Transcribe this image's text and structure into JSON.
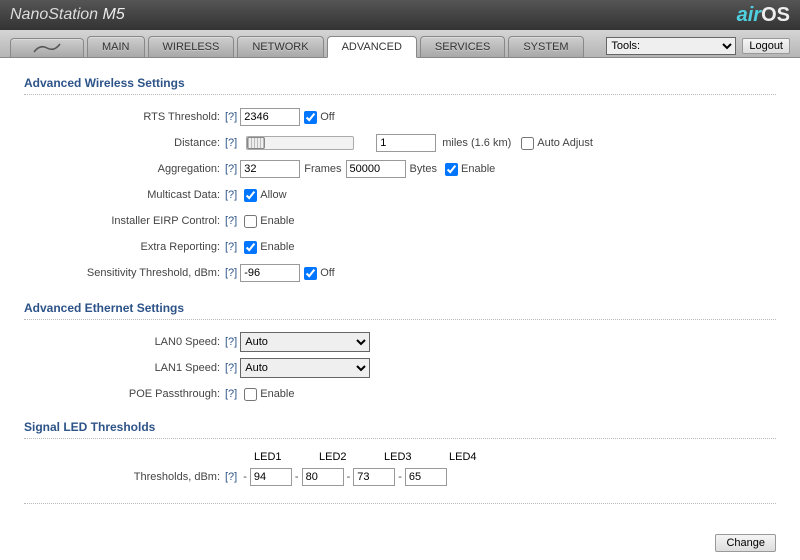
{
  "header": {
    "product_prefix": "NanoStation ",
    "product_model": "M5",
    "logo_a": "air",
    "logo_b": "OS"
  },
  "tabs": {
    "main": "MAIN",
    "wireless": "WIRELESS",
    "network": "NETWORK",
    "advanced": "ADVANCED",
    "services": "SERVICES",
    "system": "SYSTEM"
  },
  "nav": {
    "tools_label": "Tools:",
    "logout": "Logout"
  },
  "adv_wireless": {
    "title": "Advanced Wireless Settings",
    "rts_label": "RTS Threshold:",
    "rts_value": "2346",
    "rts_off_checked": true,
    "rts_off_label": "Off",
    "distance_label": "Distance:",
    "distance_value": "1",
    "distance_unit": "miles (1.6 km)",
    "auto_adjust_checked": false,
    "auto_adjust_label": "Auto Adjust",
    "agg_label": "Aggregation:",
    "agg_frames": "32",
    "agg_frames_label": "Frames",
    "agg_bytes": "50000",
    "agg_bytes_label": "Bytes",
    "agg_enable_checked": true,
    "agg_enable_label": "Enable",
    "mcast_label": "Multicast Data:",
    "mcast_checked": true,
    "mcast_clabel": "Allow",
    "eirp_label": "Installer EIRP Control:",
    "eirp_checked": false,
    "eirp_clabel": "Enable",
    "extra_label": "Extra Reporting:",
    "extra_checked": true,
    "extra_clabel": "Enable",
    "sens_label": "Sensitivity Threshold, dBm:",
    "sens_value": "-96",
    "sens_off_checked": true,
    "sens_off_label": "Off"
  },
  "adv_eth": {
    "title": "Advanced Ethernet Settings",
    "lan0_label": "LAN0 Speed:",
    "lan0_value": "Auto",
    "lan1_label": "LAN1 Speed:",
    "lan1_value": "Auto",
    "poe_label": "POE Passthrough:",
    "poe_checked": false,
    "poe_clabel": "Enable"
  },
  "led": {
    "title": "Signal LED Thresholds",
    "h1": "LED1",
    "h2": "LED2",
    "h3": "LED3",
    "h4": "LED4",
    "row_label": "Thresholds, dBm:",
    "v1": "94",
    "v2": "80",
    "v3": "73",
    "v4": "65",
    "minus": "-"
  },
  "help": "[?]",
  "footer": {
    "change": "Change"
  }
}
